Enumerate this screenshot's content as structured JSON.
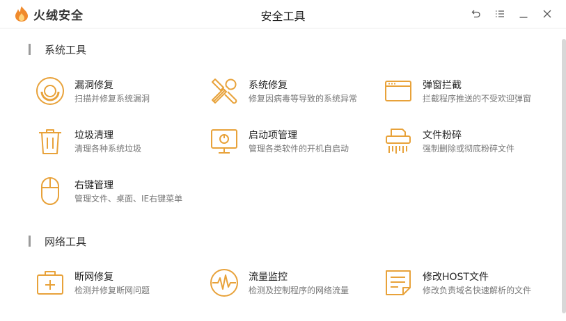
{
  "app": {
    "logo_text": "火绒安全",
    "window_title": "安全工具"
  },
  "sections": [
    {
      "title": "系统工具"
    },
    {
      "title": "网络工具"
    }
  ],
  "system_tools": [
    {
      "name": "漏洞修复",
      "desc": "扫描并修复系统漏洞",
      "icon": "vulnerability-fix-icon"
    },
    {
      "name": "系统修复",
      "desc": "修复因病毒等导致的系统异常",
      "icon": "system-repair-icon"
    },
    {
      "name": "弹窗拦截",
      "desc": "拦截程序推送的不受欢迎弹窗",
      "icon": "popup-block-icon"
    },
    {
      "name": "垃圾清理",
      "desc": "清理各种系统垃圾",
      "icon": "trash-icon"
    },
    {
      "name": "启动项管理",
      "desc": "管理各类软件的开机自启动",
      "icon": "startup-monitor-icon"
    },
    {
      "name": "文件粉碎",
      "desc": "强制删除或彻底粉碎文件",
      "icon": "shredder-icon"
    },
    {
      "name": "右键管理",
      "desc": "管理文件、桌面、IE右键菜单",
      "icon": "mouse-icon"
    }
  ],
  "network_tools": [
    {
      "name": "断网修复",
      "desc": "检测并修复断网问题",
      "icon": "first-aid-icon"
    },
    {
      "name": "流量监控",
      "desc": "检测及控制程序的网络流量",
      "icon": "traffic-monitor-icon"
    },
    {
      "name": "修改HOST文件",
      "desc": "修改负责域名快速解析的文件",
      "icon": "host-file-icon"
    }
  ],
  "colors": {
    "accent": "#E8A23A",
    "logo": "#F08A2C"
  }
}
